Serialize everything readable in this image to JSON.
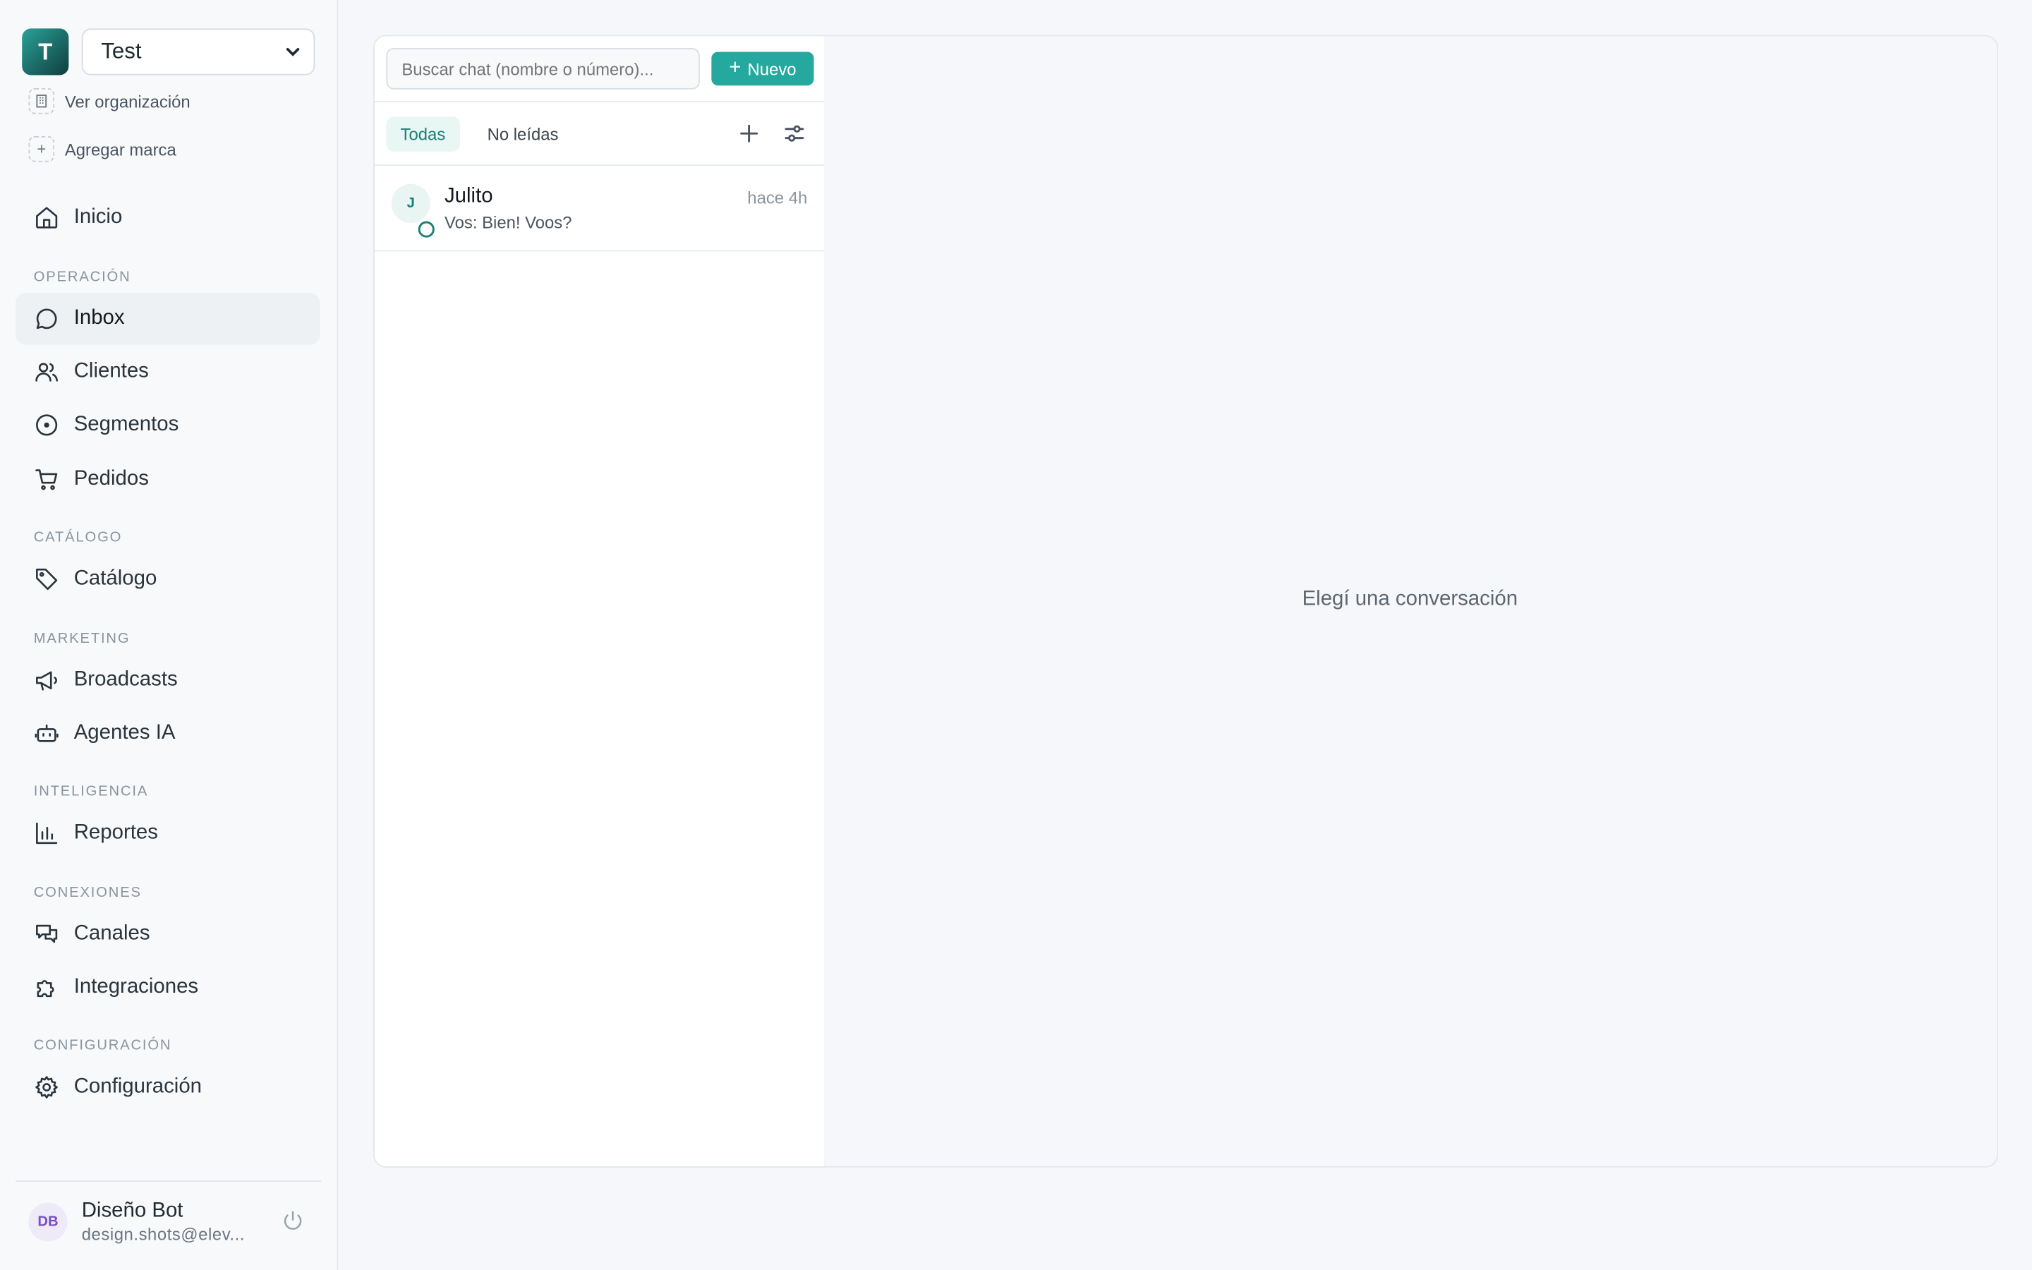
{
  "org": {
    "avatar_letter": "T",
    "selected": "Test"
  },
  "sidebar_links": {
    "view_org": "Ver organización",
    "add_brand": "Agregar marca"
  },
  "nav": {
    "home": "Inicio",
    "section_operacion": "OPERACIÓN",
    "inbox": "Inbox",
    "clients": "Clientes",
    "segments": "Segmentos",
    "orders": "Pedidos",
    "section_catalogo": "CATÁLOGO",
    "catalog": "Catálogo",
    "section_marketing": "MARKETING",
    "broadcasts": "Broadcasts",
    "agents": "Agentes IA",
    "section_inteligencia": "INTELIGENCIA",
    "reports": "Reportes",
    "section_conexiones": "CONEXIONES",
    "channels": "Canales",
    "integrations": "Integraciones",
    "section_config": "CONFIGURACIÓN",
    "settings": "Configuración"
  },
  "user": {
    "initials": "DB",
    "name": "Diseño Bot",
    "email": "design.shots@elev..."
  },
  "chat_list": {
    "search_placeholder": "Buscar chat (nombre o número)...",
    "new_label": "Nuevo",
    "tabs": [
      "Todas",
      "No leídas"
    ],
    "chats": [
      {
        "initial": "J",
        "name": "Julito",
        "time": "hace 4h",
        "preview": "Vos: Bien! Voos?"
      }
    ]
  },
  "conversation": {
    "empty_text": "Elegí una conversación"
  },
  "colors": {
    "accent": "#25a89e",
    "accent_dark": "#1b7f77"
  }
}
